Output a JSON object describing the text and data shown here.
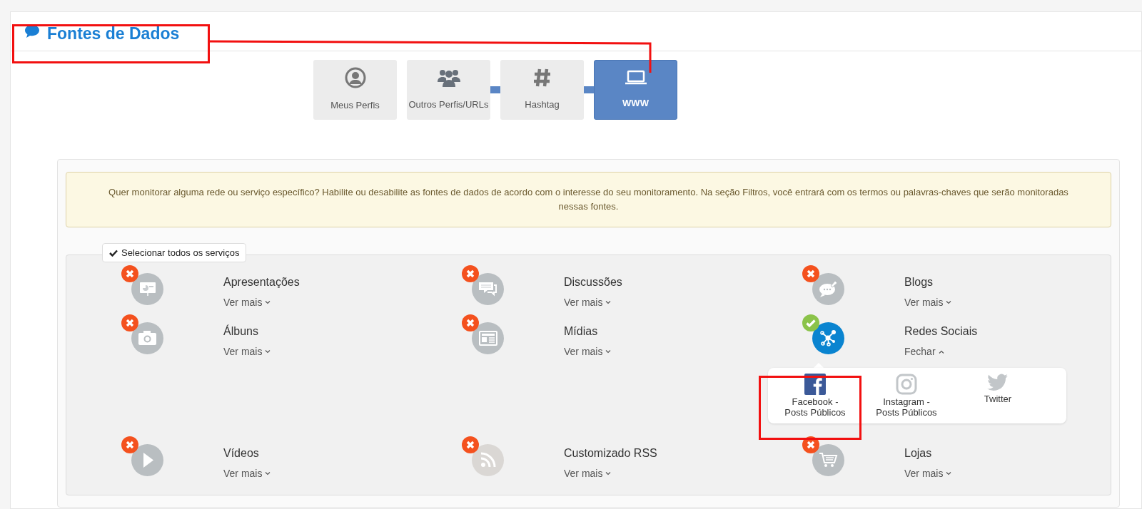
{
  "header": {
    "title": "Fontes de Dados"
  },
  "steps": [
    {
      "label": "Meus Perfis",
      "selected": false
    },
    {
      "label": "Outros Perfis/URLs",
      "selected": false,
      "linked": false
    },
    {
      "label": "Hashtag",
      "selected": false,
      "linked": true
    },
    {
      "label": "WWW",
      "selected": true,
      "linked": true
    }
  ],
  "notice": "Quer monitorar alguma rede ou serviço específico? Habilite ou desabilite as fontes de dados de acordo com o interesse do seu monitoramento. Na seção Filtros, você entrará com os termos ou palavras-chaves que serão monitoradas nessas fontes.",
  "select_all_button": "Selecionar todos os serviços",
  "services": [
    {
      "name": "Apresentações",
      "enabled": false,
      "expanded": false,
      "toggle": "Ver mais"
    },
    {
      "name": "Discussões",
      "enabled": false,
      "expanded": false,
      "toggle": "Ver mais"
    },
    {
      "name": "Blogs",
      "enabled": false,
      "expanded": false,
      "toggle": "Ver mais"
    },
    {
      "name": "Álbuns",
      "enabled": false,
      "expanded": false,
      "toggle": "Ver mais"
    },
    {
      "name": "Mídias",
      "enabled": false,
      "expanded": false,
      "toggle": "Ver mais"
    },
    {
      "name": "Redes Sociais",
      "enabled": true,
      "expanded": true,
      "toggle": "Fechar",
      "children": [
        {
          "label": "Facebook - Posts Públicos",
          "selected": true
        },
        {
          "label": "Instagram - Posts Públicos",
          "selected": false
        },
        {
          "label": "Twitter",
          "selected": false
        }
      ]
    },
    {
      "name": "Vídeos",
      "enabled": false,
      "expanded": false,
      "toggle": "Ver mais"
    },
    {
      "name": "Customizado RSS",
      "enabled": false,
      "expanded": false,
      "toggle": "Ver mais"
    },
    {
      "name": "Lojas",
      "enabled": false,
      "expanded": false,
      "toggle": "Ver mais"
    }
  ]
}
